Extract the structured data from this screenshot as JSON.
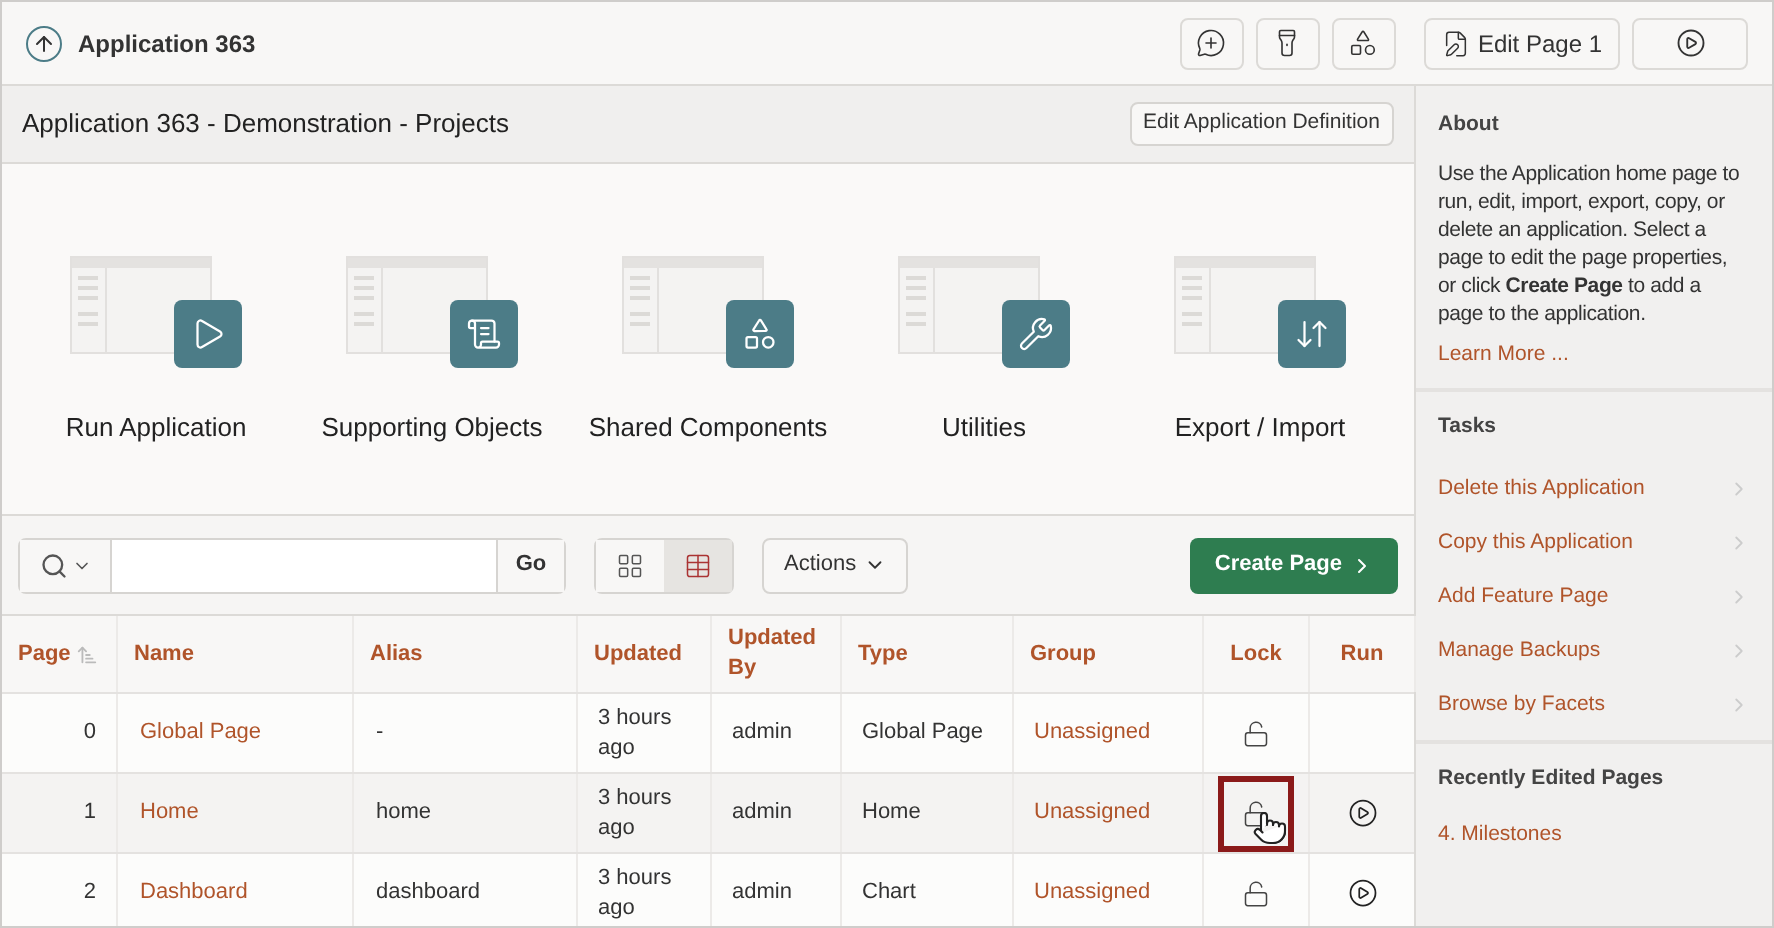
{
  "header": {
    "title": "Application 363",
    "edit_page_button": "Edit Page 1"
  },
  "app_bar": {
    "title": "Application 363 - Demonstration - Projects",
    "button": "Edit Application Definition"
  },
  "tiles": [
    {
      "label": "Run Application",
      "kind": "run"
    },
    {
      "label": "Supporting Objects",
      "kind": "objects"
    },
    {
      "label": "Shared Components",
      "kind": "shared"
    },
    {
      "label": "Utilities",
      "kind": "utilities"
    },
    {
      "label": "Export / Import",
      "kind": "export"
    }
  ],
  "toolbar": {
    "go_button": "Go",
    "views": [
      {
        "kind": "grid",
        "selected": false
      },
      {
        "kind": "report",
        "selected": true
      }
    ],
    "actions_button": "Actions",
    "create_button": "Create Page"
  },
  "table": {
    "columns": [
      "Page",
      "Name",
      "Alias",
      "Updated",
      "Updated By",
      "Type",
      "Group",
      "Lock",
      "Run"
    ],
    "rows": [
      {
        "page": "0",
        "name": "Global Page",
        "alias": "-",
        "updated": "3 hours ago",
        "updated_by": "admin",
        "type": "Global Page",
        "group": "Unassigned",
        "runnable": false,
        "hovered": false,
        "lock_highlighted": false
      },
      {
        "page": "1",
        "name": "Home",
        "alias": "home",
        "updated": "3 hours ago",
        "updated_by": "admin",
        "type": "Home",
        "group": "Unassigned",
        "runnable": true,
        "hovered": true,
        "lock_highlighted": true
      },
      {
        "page": "2",
        "name": "Dashboard",
        "alias": "dashboard",
        "updated": "3 hours ago",
        "updated_by": "admin",
        "type": "Chart",
        "group": "Unassigned",
        "runnable": true,
        "hovered": false,
        "lock_highlighted": false
      }
    ]
  },
  "sidebar": {
    "about": {
      "heading": "About",
      "text": "Use the Application home page to run, edit, import, export, copy, or delete an application. Select a page to edit the page properties, or click **Create Page** to add a page to the application.",
      "link": "Learn More ..."
    },
    "tasks": {
      "heading": "Tasks",
      "items": [
        "Delete this Application",
        "Copy this Application",
        "Add Feature Page",
        "Manage Backups",
        "Browse by Facets"
      ]
    },
    "recent": {
      "heading": "Recently Edited Pages",
      "items": [
        "4. Milestones"
      ]
    }
  }
}
